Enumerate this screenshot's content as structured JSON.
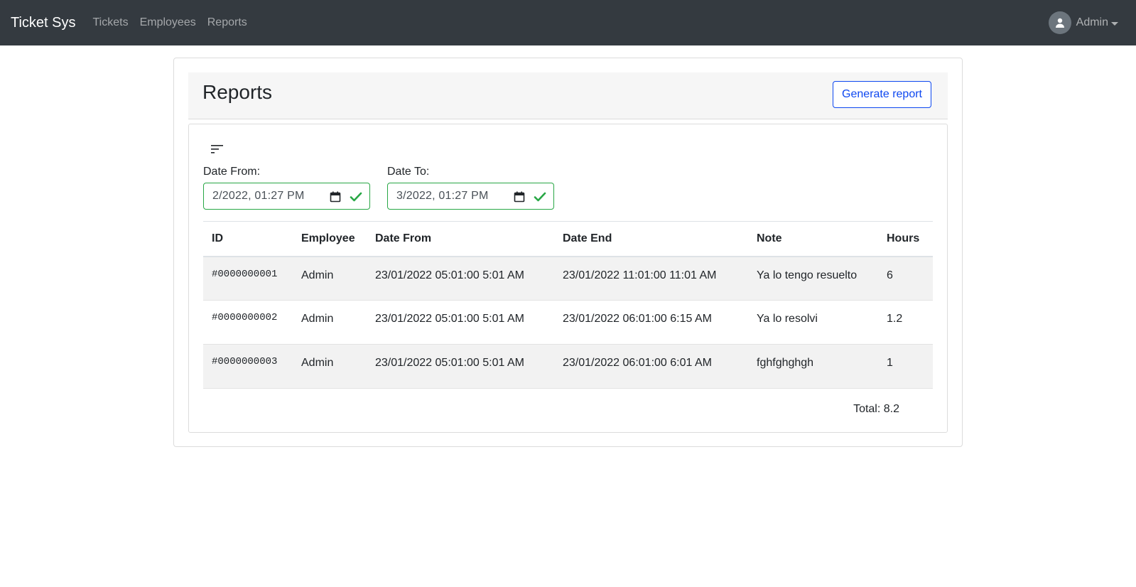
{
  "nav": {
    "brand": "Ticket Sys",
    "links": [
      "Tickets",
      "Employees",
      "Reports"
    ],
    "user": "Admin"
  },
  "header": {
    "title": "Reports",
    "generate_label": "Generate report"
  },
  "filters": {
    "from_label": "Date From:",
    "from_value": "2/2022, 01:27 PM",
    "to_label": "Date To:",
    "to_value": "3/2022, 01:27 PM"
  },
  "table": {
    "columns": [
      "ID",
      "Employee",
      "Date From",
      "Date End",
      "Note",
      "Hours"
    ],
    "rows": [
      [
        "#0000000001",
        "Admin",
        "23/01/2022 05:01:00 5:01 AM",
        "23/01/2022 11:01:00 11:01 AM",
        "Ya lo tengo resuelto",
        "6"
      ],
      [
        "#0000000002",
        "Admin",
        "23/01/2022 05:01:00 5:01 AM",
        "23/01/2022 06:01:00 6:15 AM",
        "Ya lo resolvi",
        "1.2"
      ],
      [
        "#0000000003",
        "Admin",
        "23/01/2022 05:01:00 5:01 AM",
        "23/01/2022 06:01:00 6:01 AM",
        "fghfghghgh",
        "1"
      ]
    ]
  },
  "total": "Total: 8.2",
  "colors": {
    "navbar": "#343a40",
    "accent": "#0d47f0",
    "valid": "#28a745"
  }
}
